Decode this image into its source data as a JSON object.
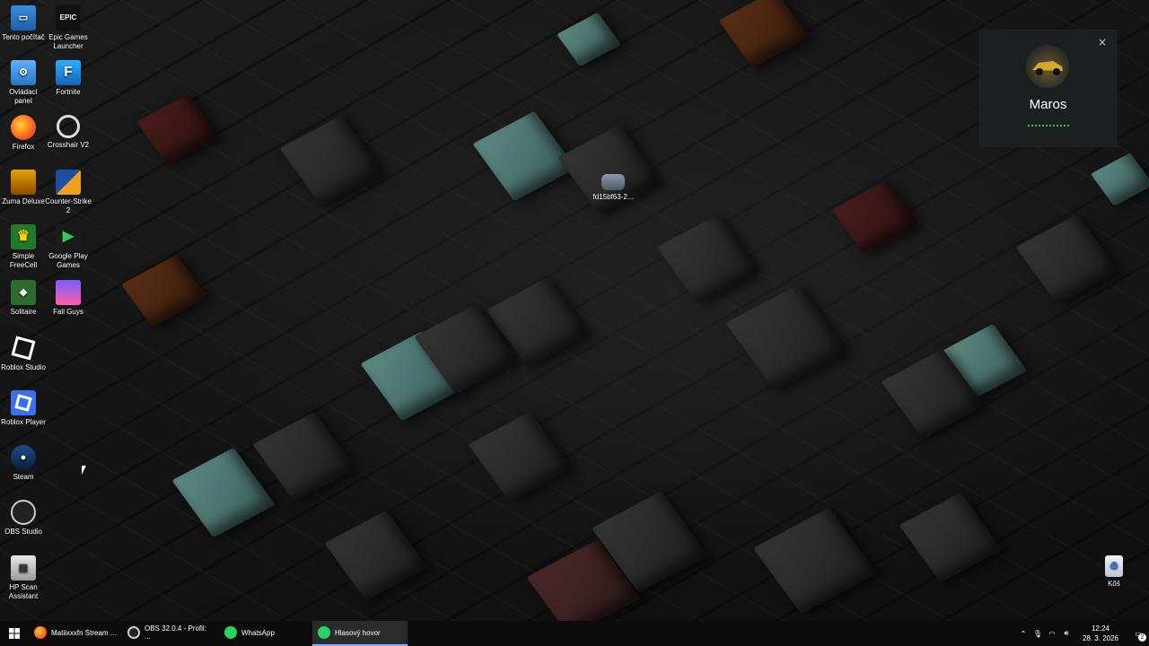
{
  "desktop_icons": [
    {
      "label": "Tento počítač",
      "icon": "computer-icon"
    },
    {
      "label": "Epic Games Launcher",
      "icon": "epic-games-icon",
      "badge": "EPIC"
    },
    {
      "label": "Ovládací panel",
      "icon": "control-panel-icon"
    },
    {
      "label": "Fortnite",
      "icon": "fortnite-icon",
      "badge": "F"
    },
    {
      "label": "Firefox",
      "icon": "firefox-icon"
    },
    {
      "label": "Crosshair V2",
      "icon": "crosshair-icon"
    },
    {
      "label": "Zuma Deluxe",
      "icon": "zuma-icon"
    },
    {
      "label": "Counter-Strike 2",
      "icon": "counter-strike-icon"
    },
    {
      "label": "Simple FreeCell",
      "icon": "freecell-icon"
    },
    {
      "label": "Google Play Games",
      "icon": "google-play-games-icon"
    },
    {
      "label": "Solitaire",
      "icon": "solitaire-icon"
    },
    {
      "label": "Fall Guys",
      "icon": "fall-guys-icon"
    },
    {
      "label": "Roblox Studio",
      "icon": "roblox-studio-icon"
    },
    {
      "label": "Roblox Player",
      "icon": "roblox-player-icon"
    },
    {
      "label": "Steam",
      "icon": "steam-icon"
    },
    {
      "label": "OBS Studio",
      "icon": "obs-icon"
    },
    {
      "label": "HP Scan Assistant",
      "icon": "hp-scan-icon"
    },
    {
      "label": "fd15bf63-2...",
      "icon": "image-file-icon"
    },
    {
      "label": "Kôš",
      "icon": "recycle-bin-icon"
    }
  ],
  "notification": {
    "name": "Maros",
    "close_glyph": "×"
  },
  "taskbar": {
    "items": [
      {
        "label": "Matiixxxfn Stream ...",
        "icon": "firefox-icon",
        "active": false
      },
      {
        "label": "OBS 32.0.4 - Profil: ...",
        "icon": "obs-icon",
        "active": false
      },
      {
        "label": "WhatsApp",
        "icon": "whatsapp-icon",
        "active": false
      },
      {
        "label": "Hlasový hovor",
        "icon": "whatsapp-icon",
        "active": true
      }
    ],
    "time": "12:24",
    "date": "28. 3. 2026",
    "notification_count": "2"
  },
  "colors": {
    "accent": "#7fb0ff",
    "whatsapp": "#25d366",
    "notif_bg": "#1b1f20"
  }
}
